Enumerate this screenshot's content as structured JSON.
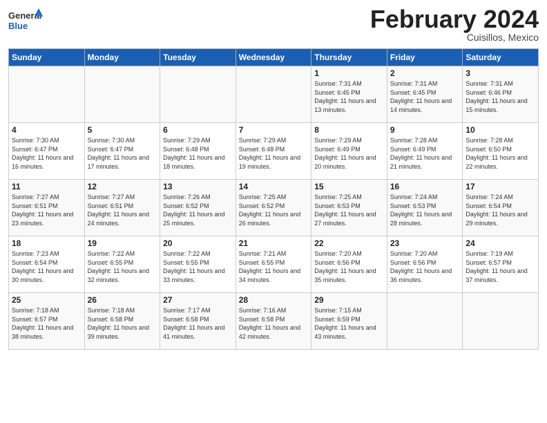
{
  "header": {
    "logo_line1": "General",
    "logo_line2": "Blue",
    "month_year": "February 2024",
    "location": "Cuisillos, Mexico"
  },
  "weekdays": [
    "Sunday",
    "Monday",
    "Tuesday",
    "Wednesday",
    "Thursday",
    "Friday",
    "Saturday"
  ],
  "weeks": [
    [
      {
        "day": "",
        "sunrise": "",
        "sunset": "",
        "daylight": ""
      },
      {
        "day": "",
        "sunrise": "",
        "sunset": "",
        "daylight": ""
      },
      {
        "day": "",
        "sunrise": "",
        "sunset": "",
        "daylight": ""
      },
      {
        "day": "",
        "sunrise": "",
        "sunset": "",
        "daylight": ""
      },
      {
        "day": "1",
        "sunrise": "Sunrise: 7:31 AM",
        "sunset": "Sunset: 6:45 PM",
        "daylight": "Daylight: 11 hours and 13 minutes."
      },
      {
        "day": "2",
        "sunrise": "Sunrise: 7:31 AM",
        "sunset": "Sunset: 6:45 PM",
        "daylight": "Daylight: 11 hours and 14 minutes."
      },
      {
        "day": "3",
        "sunrise": "Sunrise: 7:31 AM",
        "sunset": "Sunset: 6:46 PM",
        "daylight": "Daylight: 11 hours and 15 minutes."
      }
    ],
    [
      {
        "day": "4",
        "sunrise": "Sunrise: 7:30 AM",
        "sunset": "Sunset: 6:47 PM",
        "daylight": "Daylight: 11 hours and 16 minutes."
      },
      {
        "day": "5",
        "sunrise": "Sunrise: 7:30 AM",
        "sunset": "Sunset: 6:47 PM",
        "daylight": "Daylight: 11 hours and 17 minutes."
      },
      {
        "day": "6",
        "sunrise": "Sunrise: 7:29 AM",
        "sunset": "Sunset: 6:48 PM",
        "daylight": "Daylight: 11 hours and 18 minutes."
      },
      {
        "day": "7",
        "sunrise": "Sunrise: 7:29 AM",
        "sunset": "Sunset: 6:48 PM",
        "daylight": "Daylight: 11 hours and 19 minutes."
      },
      {
        "day": "8",
        "sunrise": "Sunrise: 7:29 AM",
        "sunset": "Sunset: 6:49 PM",
        "daylight": "Daylight: 11 hours and 20 minutes."
      },
      {
        "day": "9",
        "sunrise": "Sunrise: 7:28 AM",
        "sunset": "Sunset: 6:49 PM",
        "daylight": "Daylight: 11 hours and 21 minutes."
      },
      {
        "day": "10",
        "sunrise": "Sunrise: 7:28 AM",
        "sunset": "Sunset: 6:50 PM",
        "daylight": "Daylight: 11 hours and 22 minutes."
      }
    ],
    [
      {
        "day": "11",
        "sunrise": "Sunrise: 7:27 AM",
        "sunset": "Sunset: 6:51 PM",
        "daylight": "Daylight: 11 hours and 23 minutes."
      },
      {
        "day": "12",
        "sunrise": "Sunrise: 7:27 AM",
        "sunset": "Sunset: 6:51 PM",
        "daylight": "Daylight: 11 hours and 24 minutes."
      },
      {
        "day": "13",
        "sunrise": "Sunrise: 7:26 AM",
        "sunset": "Sunset: 6:52 PM",
        "daylight": "Daylight: 11 hours and 25 minutes."
      },
      {
        "day": "14",
        "sunrise": "Sunrise: 7:25 AM",
        "sunset": "Sunset: 6:52 PM",
        "daylight": "Daylight: 11 hours and 26 minutes."
      },
      {
        "day": "15",
        "sunrise": "Sunrise: 7:25 AM",
        "sunset": "Sunset: 6:53 PM",
        "daylight": "Daylight: 11 hours and 27 minutes."
      },
      {
        "day": "16",
        "sunrise": "Sunrise: 7:24 AM",
        "sunset": "Sunset: 6:53 PM",
        "daylight": "Daylight: 11 hours and 28 minutes."
      },
      {
        "day": "17",
        "sunrise": "Sunrise: 7:24 AM",
        "sunset": "Sunset: 6:54 PM",
        "daylight": "Daylight: 11 hours and 29 minutes."
      }
    ],
    [
      {
        "day": "18",
        "sunrise": "Sunrise: 7:23 AM",
        "sunset": "Sunset: 6:54 PM",
        "daylight": "Daylight: 11 hours and 30 minutes."
      },
      {
        "day": "19",
        "sunrise": "Sunrise: 7:22 AM",
        "sunset": "Sunset: 6:55 PM",
        "daylight": "Daylight: 11 hours and 32 minutes."
      },
      {
        "day": "20",
        "sunrise": "Sunrise: 7:22 AM",
        "sunset": "Sunset: 6:55 PM",
        "daylight": "Daylight: 11 hours and 33 minutes."
      },
      {
        "day": "21",
        "sunrise": "Sunrise: 7:21 AM",
        "sunset": "Sunset: 6:55 PM",
        "daylight": "Daylight: 11 hours and 34 minutes."
      },
      {
        "day": "22",
        "sunrise": "Sunrise: 7:20 AM",
        "sunset": "Sunset: 6:56 PM",
        "daylight": "Daylight: 11 hours and 35 minutes."
      },
      {
        "day": "23",
        "sunrise": "Sunrise: 7:20 AM",
        "sunset": "Sunset: 6:56 PM",
        "daylight": "Daylight: 11 hours and 36 minutes."
      },
      {
        "day": "24",
        "sunrise": "Sunrise: 7:19 AM",
        "sunset": "Sunset: 6:57 PM",
        "daylight": "Daylight: 11 hours and 37 minutes."
      }
    ],
    [
      {
        "day": "25",
        "sunrise": "Sunrise: 7:18 AM",
        "sunset": "Sunset: 6:57 PM",
        "daylight": "Daylight: 11 hours and 38 minutes."
      },
      {
        "day": "26",
        "sunrise": "Sunrise: 7:18 AM",
        "sunset": "Sunset: 6:58 PM",
        "daylight": "Daylight: 11 hours and 39 minutes."
      },
      {
        "day": "27",
        "sunrise": "Sunrise: 7:17 AM",
        "sunset": "Sunset: 6:58 PM",
        "daylight": "Daylight: 11 hours and 41 minutes."
      },
      {
        "day": "28",
        "sunrise": "Sunrise: 7:16 AM",
        "sunset": "Sunset: 6:58 PM",
        "daylight": "Daylight: 11 hours and 42 minutes."
      },
      {
        "day": "29",
        "sunrise": "Sunrise: 7:15 AM",
        "sunset": "Sunset: 6:59 PM",
        "daylight": "Daylight: 11 hours and 43 minutes."
      },
      {
        "day": "",
        "sunrise": "",
        "sunset": "",
        "daylight": ""
      },
      {
        "day": "",
        "sunrise": "",
        "sunset": "",
        "daylight": ""
      }
    ]
  ]
}
